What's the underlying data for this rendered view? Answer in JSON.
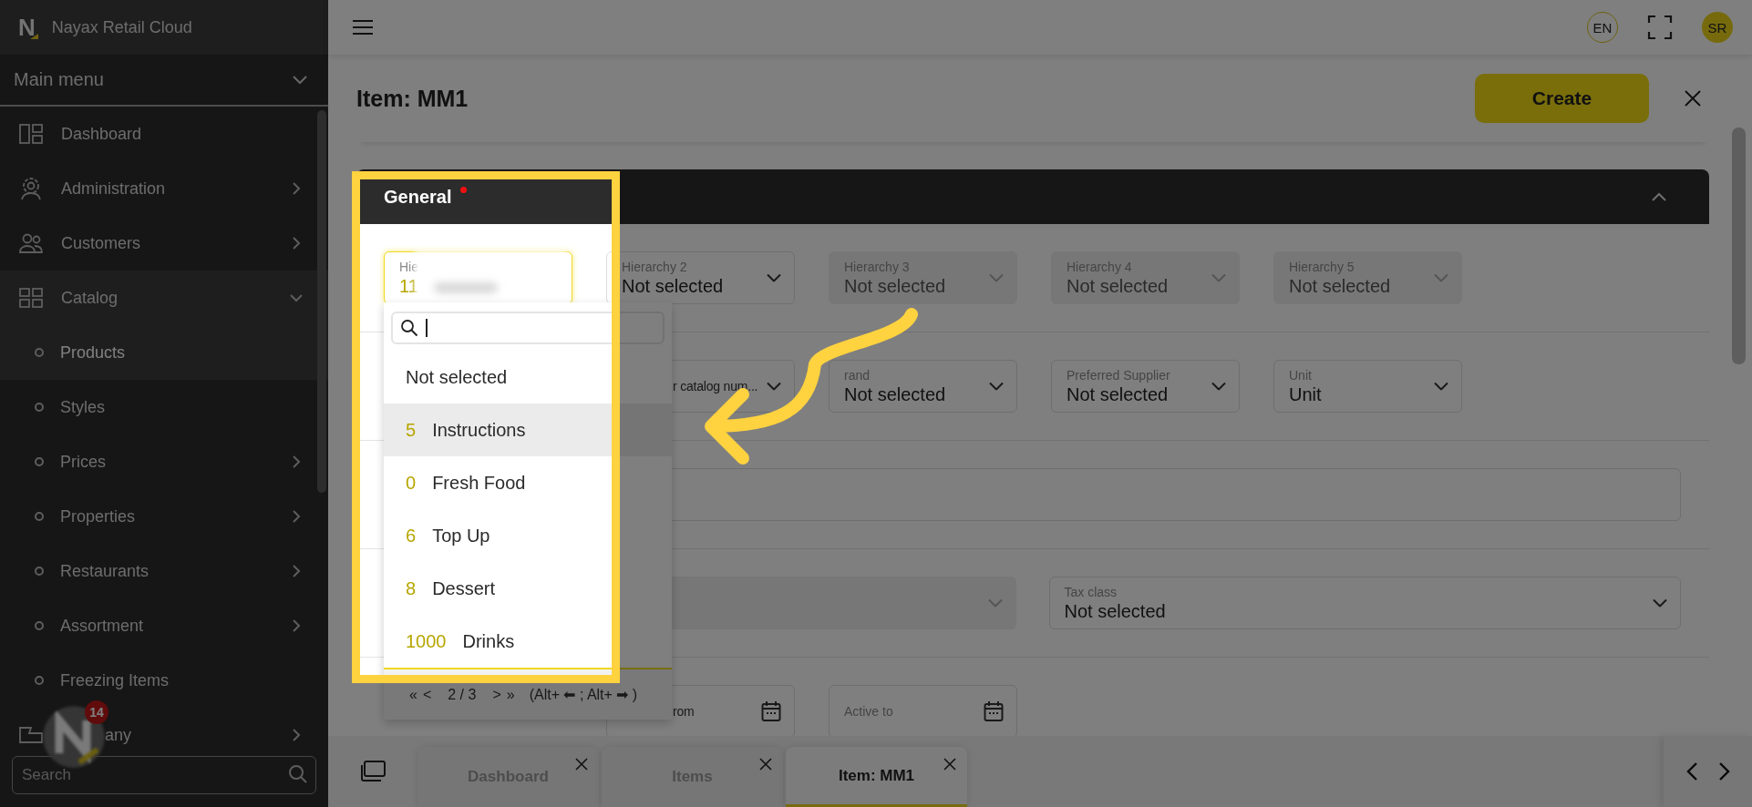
{
  "app": {
    "logo_letter": "N",
    "name": "Nayax Retail Cloud"
  },
  "sidebar": {
    "menu_title": "Main menu",
    "items": [
      {
        "label": "Dashboard",
        "expandable": false
      },
      {
        "label": "Administration",
        "expandable": true,
        "expanded": false
      },
      {
        "label": "Customers",
        "expandable": true,
        "expanded": false
      },
      {
        "label": "Catalog",
        "expandable": true,
        "expanded": true,
        "children": [
          {
            "label": "Products",
            "expandable": false,
            "selected": true
          },
          {
            "label": "Styles",
            "expandable": false,
            "selected": false
          },
          {
            "label": "Prices",
            "expandable": true,
            "selected": false
          },
          {
            "label": "Properties",
            "expandable": true,
            "selected": false
          },
          {
            "label": "Restaurants",
            "expandable": true,
            "selected": false
          },
          {
            "label": "Assortment",
            "expandable": true,
            "selected": false
          },
          {
            "label": "Freezing Items",
            "expandable": false,
            "selected": false
          }
        ]
      },
      {
        "label": "any",
        "expandable": true,
        "expanded": false
      }
    ],
    "search": {
      "placeholder": "Search"
    },
    "bubble": {
      "count": "14"
    }
  },
  "topbar": {
    "language": "EN",
    "user_initials": "SR"
  },
  "page": {
    "title": "Item: MM1",
    "create_button": "Create"
  },
  "section": {
    "title": "General",
    "required": true,
    "expanded": true,
    "rows": [
      {
        "kind": "narrow",
        "fields": [
          {
            "kind": "select",
            "label": "Hie",
            "value": "11",
            "focused": true,
            "disabled": false,
            "redacted": true,
            "open": true
          },
          {
            "kind": "select",
            "label": "Hierarchy 2",
            "value": "Not selected",
            "focused": false,
            "disabled": false
          },
          {
            "kind": "select",
            "label": "Hierarchy 3",
            "value": "Not selected",
            "focused": false,
            "disabled": true
          },
          {
            "kind": "select",
            "label": "Hierarchy 4",
            "value": "Not selected",
            "focused": false,
            "disabled": true
          },
          {
            "kind": "select",
            "label": "Hierarchy 5",
            "value": "Not selected",
            "focused": false,
            "disabled": true
          }
        ]
      },
      {
        "kind": "after_menu",
        "fields": [
          {
            "kind": "select",
            "label": "r catalog num...",
            "covered_by_menu": true,
            "focused": false,
            "disabled": false
          },
          {
            "kind": "select",
            "label": "rand",
            "value": "Not selected",
            "focused": false,
            "disabled": false
          },
          {
            "kind": "select",
            "label": "Preferred Supplier",
            "value": "Not selected",
            "focused": false,
            "disabled": false
          },
          {
            "kind": "select",
            "label": "Unit",
            "value": "Unit",
            "focused": false,
            "disabled": false
          }
        ]
      },
      {
        "kind": "full",
        "fields": [
          {
            "kind": "text",
            "focused": false
          }
        ]
      },
      {
        "kind": "half",
        "fields": [
          {
            "kind": "select",
            "focused": false,
            "disabled": true
          },
          {
            "kind": "select",
            "label": "Tax class",
            "value": "Not selected",
            "focused": false,
            "disabled": false
          }
        ]
      },
      {
        "kind": "after_menu",
        "fields": [
          {
            "kind": "date",
            "label": "rom",
            "covered_by_menu": true,
            "focused": false
          },
          {
            "kind": "date",
            "label": "Active to",
            "focused": false
          }
        ]
      }
    ]
  },
  "dropdown": {
    "options": [
      {
        "label": "Not selected",
        "selected": false
      },
      {
        "code": "5",
        "label": "Instructions",
        "selected": true
      },
      {
        "code": "0",
        "label": "Fresh Food",
        "selected": false
      },
      {
        "code": "6",
        "label": "Top Up",
        "selected": false
      },
      {
        "code": "8",
        "label": "Dessert",
        "selected": false
      },
      {
        "code": "1000",
        "label": "Drinks",
        "selected": false
      }
    ],
    "pager": {
      "first": "«",
      "prev": "<",
      "page": "2 / 3",
      "next": ">",
      "last": "»",
      "hint": "(Alt+ ⬅ ; Alt+ ➡ )"
    }
  },
  "tabs": [
    {
      "label": "Dashboard",
      "selected": false
    },
    {
      "label": "Items",
      "selected": false
    },
    {
      "label": "Item: MM1",
      "selected": true
    }
  ]
}
